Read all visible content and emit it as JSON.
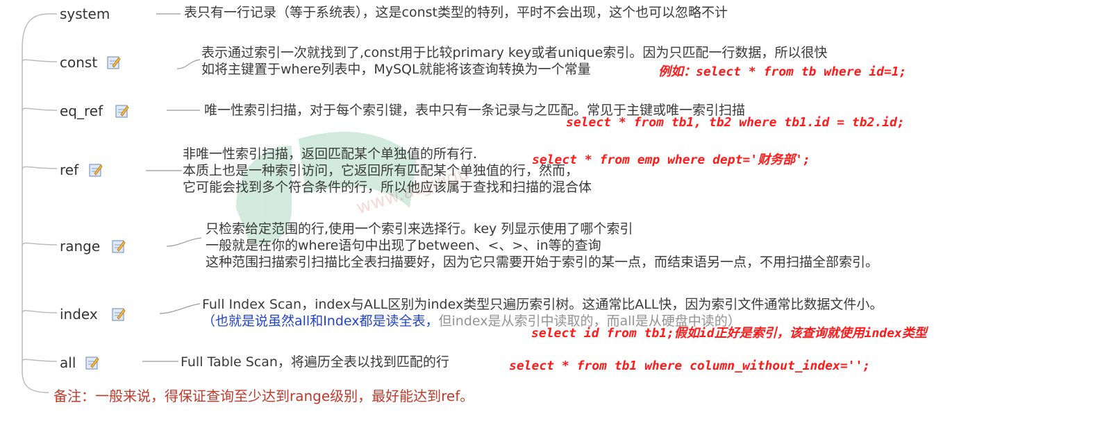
{
  "watermark": "www.atguigu",
  "rows": [
    {
      "key": "system",
      "name": "system",
      "icon": false,
      "desc": [
        "表只有一行记录（等于系统表），这是const类型的特列，平时不会出现，这个也可以忽略不计"
      ],
      "sql": ""
    },
    {
      "key": "const",
      "name": "const",
      "icon": true,
      "desc": [
        "表示通过索引一次就找到了,const用于比较primary key或者unique索引。因为只匹配一行数据，所以很快",
        "如将主键置于where列表中，MySQL就能将该查询转换为一个常量"
      ],
      "sql": "例如：select * from tb where id=1;"
    },
    {
      "key": "eq_ref",
      "name": "eq_ref",
      "icon": true,
      "desc": [
        "唯一性索引扫描，对于每个索引键，表中只有一条记录与之匹配。常见于主键或唯一索引扫描"
      ],
      "sql": "select * from tb1, tb2 where tb1.id = tb2.id;"
    },
    {
      "key": "ref",
      "name": "ref",
      "icon": true,
      "desc": [
        "非唯一性索引扫描，返回匹配某个单独值的所有行.",
        "本质上也是一种索引访问，它返回所有匹配某个单独值的行，然而，",
        "它可能会找到多个符合条件的行，所以他应该属于查找和扫描的混合体"
      ],
      "sql": "select * from emp where dept='财务部';"
    },
    {
      "key": "range",
      "name": "range",
      "icon": true,
      "desc": [
        "只检索给定范围的行,使用一个索引来选择行。key 列显示使用了哪个索引",
        "一般就是在你的where语句中出现了between、<、>、in等的查询",
        "这种范围扫描索引扫描比全表扫描要好，因为它只需要开始于索引的某一点，而结束语另一点，不用扫描全部索引。"
      ],
      "sql": ""
    },
    {
      "key": "index",
      "name": "index",
      "icon": true,
      "desc": [
        "Full Index Scan，index与ALL区别为index类型只遍历索引树。这通常比ALL快，因为索引文件通常比数据文件小。"
      ],
      "desc_blue": "（也就是说虽然all和Index都是读全表，",
      "desc_tail": "但index是从索引中读取的，而all是从硬盘中读的）",
      "sql": "select id from tb1;假如id正好是索引，该查询就使用index类型"
    },
    {
      "key": "all",
      "name": "all",
      "icon": true,
      "desc": [
        "Full Table Scan，将遍历全表以找到匹配的行"
      ],
      "sql": "select * from tb1 where column_without_index='';"
    }
  ],
  "note": "备注：一般来说，得保证查询至少达到range级别，最好能达到ref。"
}
